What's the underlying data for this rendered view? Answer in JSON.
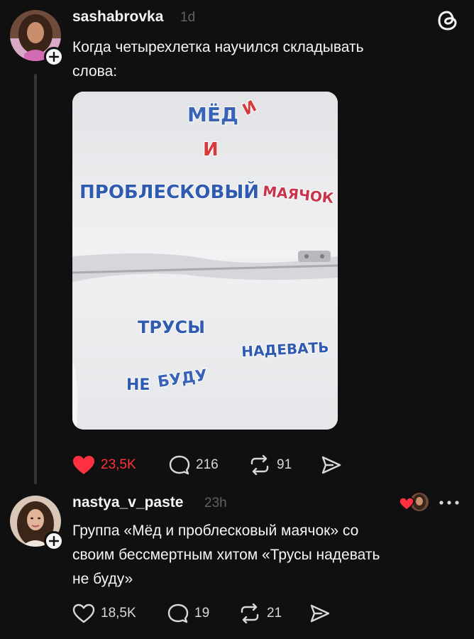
{
  "post": {
    "username": "sashabrovka",
    "time": "1d",
    "text_lines": [
      "Когда четырехлетка научился складывать",
      "слова:"
    ],
    "image": {
      "magnet_words": [
        "МЁД",
        "И",
        "ПРОБЛЕСКОВЫЙ",
        "МАЯЧОК",
        "ТРУСЫ",
        "НАДЕВАТЬ",
        "НЕ",
        "БУДУ"
      ]
    },
    "actions": {
      "likes": "23,5K",
      "comments": "216",
      "reposts": "91"
    },
    "liked": true
  },
  "reply": {
    "username": "nastya_v_paste",
    "time": "23h",
    "text_lines": [
      "Группа «Мёд и проблесковый маячок» со",
      "своим бессмертным хитом «Трусы надевать",
      "не буду»"
    ],
    "actions": {
      "likes": "18,5K",
      "comments": "19",
      "reposts": "21"
    },
    "liked": false
  },
  "colors": {
    "background": "#101010",
    "text": "#f3f5f7",
    "muted": "#616161",
    "like": "#ff3040",
    "thread_line": "#333638"
  },
  "icons": [
    "threads-logo-icon",
    "plus-icon",
    "heart-icon",
    "comment-icon",
    "repost-icon",
    "share-icon",
    "more-icon"
  ]
}
